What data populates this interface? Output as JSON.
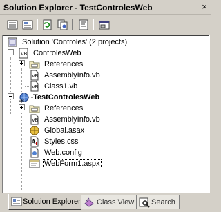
{
  "window": {
    "title": "Solution Explorer - TestControlesWeb",
    "close_glyph": "×"
  },
  "toolbar": [
    {
      "name": "properties",
      "icon": "properties-icon"
    },
    {
      "name": "show-all-files",
      "icon": "show-all-files-icon"
    },
    {
      "name": "refresh",
      "icon": "refresh-icon"
    },
    {
      "name": "copy-project",
      "icon": "copy-project-icon"
    },
    {
      "name": "view-code",
      "icon": "view-code-icon"
    },
    {
      "name": "view-designer",
      "icon": "view-designer-icon"
    }
  ],
  "tree": {
    "solution_label": "Solution 'Controles' (2 projects)",
    "projects": [
      {
        "label": "ControlesWeb",
        "items": [
          "References",
          "AssemblyInfo.vb",
          "Class1.vb"
        ]
      },
      {
        "label": "TestControlesWeb",
        "items": [
          "References",
          "AssemblyInfo.vb",
          "Global.asax",
          "Styles.css",
          "Web.config",
          "WebForm1.aspx"
        ]
      }
    ]
  },
  "tabs": [
    {
      "label": "Solution Explorer",
      "active": true
    },
    {
      "label": "Class View",
      "active": false
    },
    {
      "label": "Search",
      "active": false
    }
  ]
}
